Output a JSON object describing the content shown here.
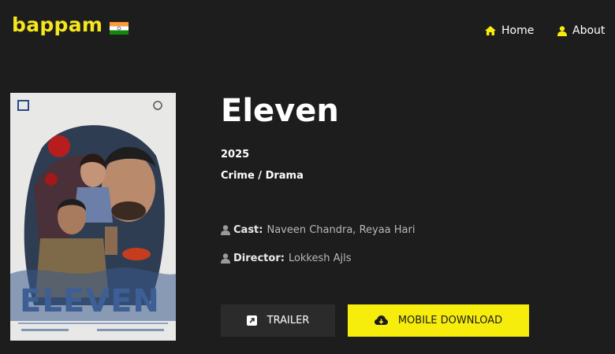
{
  "header": {
    "logo_text": "bappam",
    "nav": [
      {
        "label": "Home",
        "icon": "home-icon"
      },
      {
        "label": "About",
        "icon": "user-icon"
      }
    ]
  },
  "movie": {
    "title": "Eleven",
    "year": "2025",
    "genre": "Crime / Drama",
    "cast_label": "Cast:",
    "cast_value": "Naveen Chandra, Reyaa Hari",
    "director_label": "Director:",
    "director_value": "Lokkesh Ajls",
    "poster_title": "ELEVEN"
  },
  "buttons": {
    "trailer_label": "TRAILER",
    "download_label": "MOBILE DOWNLOAD"
  },
  "colors": {
    "background": "#1d1d1d",
    "accent": "#f7ed0d",
    "logo": "#f5e71c",
    "secondary_button": "#2b2b2b"
  }
}
